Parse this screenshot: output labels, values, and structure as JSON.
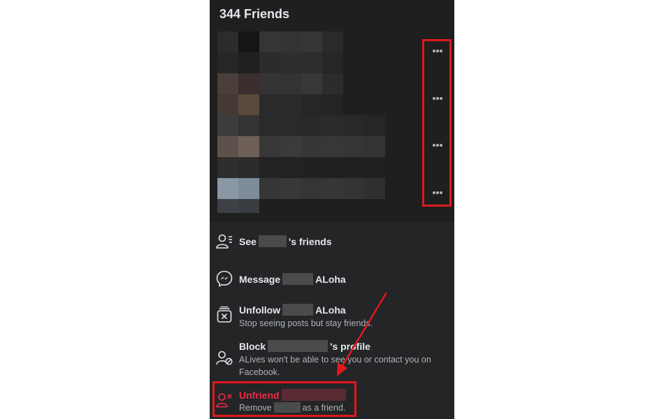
{
  "friends_header": {
    "title": "344 Friends"
  },
  "menu": {
    "see_friends": {
      "prefix": "See",
      "suffix": "'s friends"
    },
    "message": {
      "prefix": "Message",
      "suffix": "ALoha"
    },
    "unfollow": {
      "prefix": "Unfollow",
      "suffix": "ALoha",
      "subtitle": "Stop seeing posts but stay friends."
    },
    "block": {
      "prefix": "Block",
      "suffix": "'s profile",
      "subtitle_line1": "ALives won't be able to see you or contact you on",
      "subtitle_line2": "Facebook."
    },
    "unfriend": {
      "prefix": "Unfriend",
      "sub_prefix": "Remove",
      "sub_suffix": "as a friend."
    }
  },
  "colors": {
    "accent_red": "#f02849",
    "annotation_red": "#e0191e",
    "panel_bg": "#242526"
  },
  "icons": [
    "more-options-icon",
    "see-friends-icon",
    "messenger-icon",
    "unfollow-icon",
    "block-icon",
    "unfriend-icon"
  ]
}
